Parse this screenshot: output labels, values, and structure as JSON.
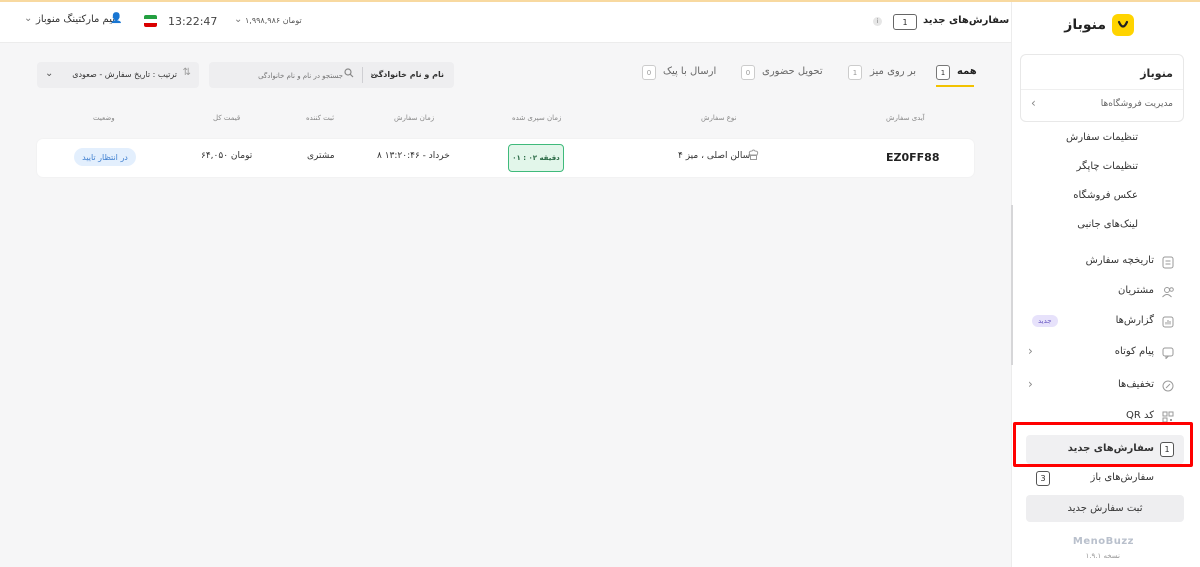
{
  "header": {
    "new_orders_label": "سفارش‌های جدید",
    "new_orders_count": "1",
    "team_name": "تیم مارکتینگ منوباز",
    "time": "13:22:47",
    "balance": "۱,۹۹۸,۹۸۶ تومان"
  },
  "sidebar": {
    "logo_text": "منوباز",
    "store_name": "منوباز",
    "store_manage": "مدیریت فروشگاه‌ها",
    "sub_items": [
      "تنظیمات سفارش",
      "تنظیمات چاپگر",
      "عکس فروشگاه",
      "لینک‌های جانبی"
    ],
    "nav": {
      "history": "تاریخچه سفارش",
      "customers": "مشتریان",
      "reports": "گزارش‌ها",
      "reports_badge": "جدید",
      "sms": "پیام کوتاه",
      "discounts": "تخفیف‌ها",
      "qr": "کد QR",
      "new_orders": "سفارش‌های جدید",
      "new_orders_count": "1",
      "open_orders": "سفارش‌های باز",
      "open_orders_count": "3"
    },
    "new_order_button": "ثبت سفارش جدید",
    "brand": "MenoBuzz",
    "version": "نسخه ۱.۹.۱"
  },
  "filters": {
    "sort_label": "ترتیب : تاریخ سفارش - صعودی",
    "search_placeholder": "جستجو در نام و نام خانوادگی",
    "search_field": "نام و نام خانوادگی",
    "tabs": [
      {
        "label": "همه",
        "count": "1"
      },
      {
        "label": "بر روی میز",
        "count": "1"
      },
      {
        "label": "تحویل حضوری",
        "count": "0"
      },
      {
        "label": "ارسال با پیک",
        "count": "0"
      }
    ]
  },
  "table": {
    "headers": [
      "آیدی سفارش",
      "نوع سفارش",
      "زمان سپری شده",
      "زمان سفارش",
      "ثبت کننده",
      "قیمت کل",
      "وضعیت"
    ],
    "rows": [
      {
        "order_id": "EZ0FF88",
        "type": "سالن اصلی ، میز ۴",
        "elapsed": "۰۱ : ۰۲ دقیقه",
        "order_time": "۸ خرداد - ۱۳:۲۰:۴۶",
        "creator": "مشتری",
        "total": "۶۴,۰۵۰ تومان",
        "status": "در انتظار تایید"
      }
    ]
  },
  "colors": {
    "accent": "#ffd400",
    "highlight": "#ff0000",
    "status_bg": "#e3effd",
    "elapsed_border": "#3fba7b"
  }
}
